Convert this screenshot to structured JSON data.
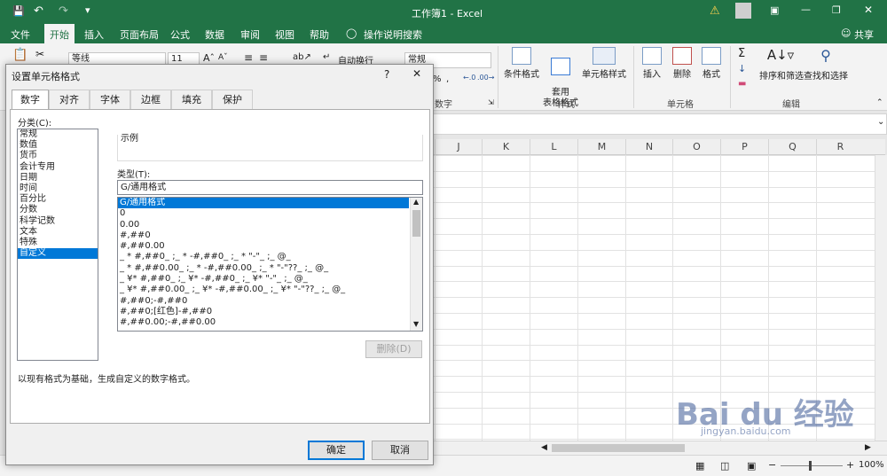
{
  "title_bar": {
    "doc_title": "工作簿1  -  Excel",
    "user_initial": "",
    "window_controls": [
      "minimize",
      "restore",
      "close"
    ]
  },
  "ribbon_tabs": [
    "文件",
    "开始",
    "插入",
    "页面布局",
    "公式",
    "数据",
    "审阅",
    "视图",
    "帮助",
    "操作说明搜索"
  ],
  "active_tab": "开始",
  "share_label": "共享",
  "ribbon": {
    "font_name": "等线",
    "font_size": "11",
    "wrap_text": "自动换行",
    "number_format": "常规",
    "group_number": "数字",
    "cond_format": "条件格式",
    "table_format": "套用\n表格格式",
    "cell_styles": "单元格样式",
    "group_styles": "样式",
    "insert": "插入",
    "delete": "删除",
    "format": "格式",
    "group_cells": "单元格",
    "sort_filter": "排序和筛选",
    "find_select": "查找和选择",
    "group_editing": "编辑"
  },
  "columns": [
    "J",
    "K",
    "L",
    "M",
    "N",
    "O",
    "P",
    "Q",
    "R"
  ],
  "statusbar": {
    "zoom": "100%"
  },
  "dialog": {
    "title": "设置单元格格式",
    "help": "?",
    "close": "✕",
    "tabs": [
      "数字",
      "对齐",
      "字体",
      "边框",
      "填充",
      "保护"
    ],
    "active_tab": "数字",
    "category_label": "分类(C):",
    "categories": [
      "常规",
      "数值",
      "货币",
      "会计专用",
      "日期",
      "时间",
      "百分比",
      "分数",
      "科学记数",
      "文本",
      "特殊",
      "自定义"
    ],
    "selected_category": "自定义",
    "sample_label": "示例",
    "type_label": "类型(T):",
    "type_value": "G/通用格式",
    "formats": [
      "G/通用格式",
      "0",
      "0.00",
      "#,##0",
      "#,##0.00",
      "_ * #,##0_ ;_ * -#,##0_ ;_ * \"-\"_ ;_ @_",
      "_ * #,##0.00_ ;_ * -#,##0.00_ ;_ * \"-\"??_ ;_ @_",
      "_ ¥* #,##0_ ;_ ¥* -#,##0_ ;_ ¥* \"-\"_ ;_ @_",
      "_ ¥* #,##0.00_ ;_ ¥* -#,##0.00_ ;_ ¥* \"-\"??_ ;_ @_",
      "#,##0;-#,##0",
      "#,##0;[红色]-#,##0",
      "#,##0.00;-#,##0.00"
    ],
    "delete_btn": "删除(D)",
    "description": "以现有格式为基础，生成自定义的数字格式。",
    "ok": "确定",
    "cancel": "取消"
  },
  "watermark": {
    "line1": "Bai du 经验",
    "line2": "jingyan.baidu.com"
  },
  "colors": {
    "excel_green": "#217346",
    "selection_blue": "#0078d7"
  }
}
